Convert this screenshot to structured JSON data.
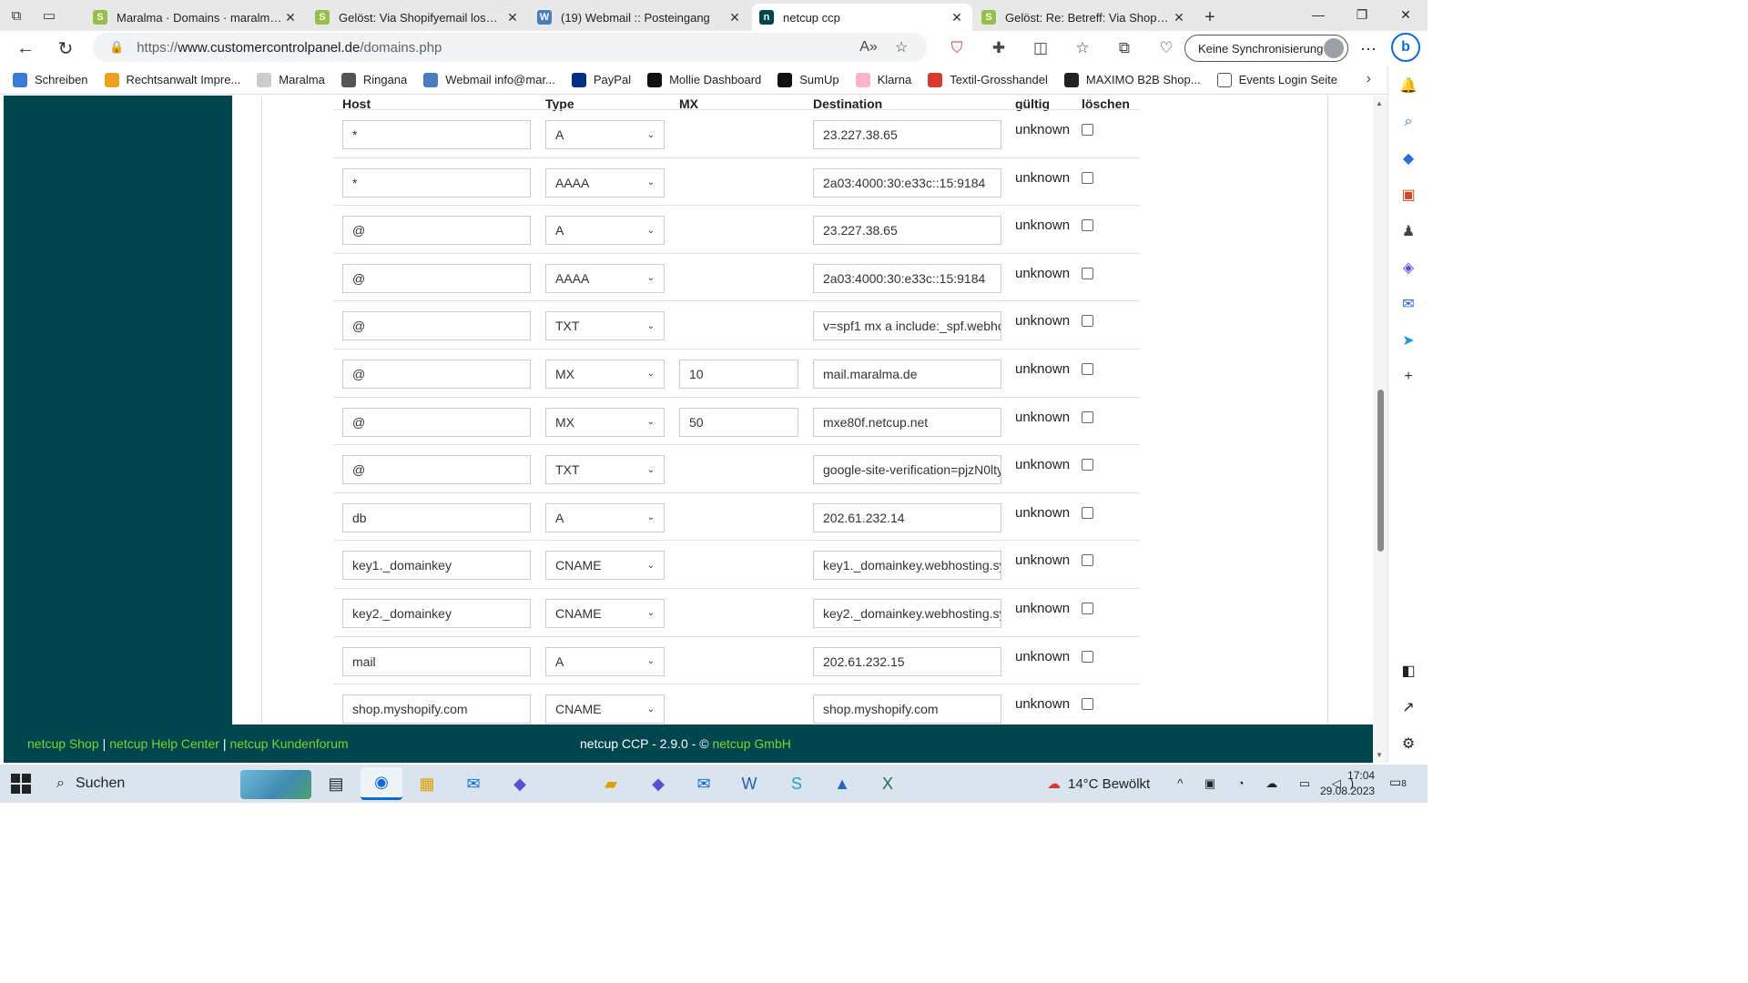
{
  "browser": {
    "tabs": [
      {
        "title": "Maralma · Domains · maralma.de",
        "fav_color": "#95bf47",
        "fav_glyph": "S",
        "active": false
      },
      {
        "title": "Gelöst: Via Shopifyemail loswerden",
        "fav_color": "#95bf47",
        "fav_glyph": "S",
        "active": false
      },
      {
        "title": "(19) Webmail :: Posteingang",
        "fav_color": "#4a7cc0",
        "fav_glyph": "W",
        "active": false
      },
      {
        "title": "netcup ccp",
        "fav_color": "#00464f",
        "fav_glyph": "n",
        "active": true
      },
      {
        "title": "Gelöst: Re: Betreff: Via Shopifyemail",
        "fav_color": "#95bf47",
        "fav_glyph": "S",
        "active": false
      }
    ],
    "url_prefix": "https://",
    "url_host": "www.customercontrolpanel.de",
    "url_path": "/domains.php",
    "sync_label": "Keine Synchronisierung"
  },
  "bookmarks": [
    {
      "label": "Schreiben",
      "color": "#3a7bd5"
    },
    {
      "label": "Rechtsanwalt Impre...",
      "color": "#f0a020"
    },
    {
      "label": "Maralma",
      "color": "#cccccc"
    },
    {
      "label": "Ringana",
      "color": "#555555"
    },
    {
      "label": "Webmail info@mar...",
      "color": "#4a7cc0"
    },
    {
      "label": "PayPal",
      "color": "#003087"
    },
    {
      "label": "Mollie Dashboard",
      "color": "#111111"
    },
    {
      "label": "SumUp",
      "color": "#111111"
    },
    {
      "label": "Klarna",
      "color": "#ffb3c7"
    },
    {
      "label": "Textil-Grosshandel",
      "color": "#d63a2a"
    },
    {
      "label": "MAXIMO B2B Shop...",
      "color": "#222222"
    },
    {
      "label": "Events Login Seite",
      "color": "#ffffff"
    }
  ],
  "table": {
    "headers": {
      "host": "Host",
      "type": "Type",
      "mx": "MX",
      "destination": "Destination",
      "valid": "gültig",
      "delete": "löschen"
    },
    "rows": [
      {
        "host": "*",
        "type": "A",
        "mx": "",
        "destination": " 23.227.38.65",
        "status": "unknown"
      },
      {
        "host": "*",
        "type": "AAAA",
        "mx": "",
        "destination": "2a03:4000:30:e33c::15:9184",
        "status": "unknown"
      },
      {
        "host": "@",
        "type": "A",
        "mx": "",
        "destination": " 23.227.38.65",
        "status": "unknown"
      },
      {
        "host": "@",
        "type": "AAAA",
        "mx": "",
        "destination": "2a03:4000:30:e33c::15:9184",
        "status": "unknown"
      },
      {
        "host": "@",
        "type": "TXT",
        "mx": "",
        "destination": "v=spf1 mx a include:_spf.webho",
        "status": "unknown"
      },
      {
        "host": "@",
        "type": "MX",
        "mx": "10",
        "destination": "mail.maralma.de",
        "status": "unknown"
      },
      {
        "host": "@",
        "type": "MX",
        "mx": "50",
        "destination": "mxe80f.netcup.net",
        "status": "unknown"
      },
      {
        "host": "@",
        "type": "TXT",
        "mx": "",
        "destination": "google-site-verification=pjzN0lty",
        "status": "unknown"
      },
      {
        "host": "db",
        "type": "A",
        "mx": "",
        "destination": "202.61.232.14",
        "status": "unknown"
      },
      {
        "host": "key1._domainkey",
        "type": "CNAME",
        "mx": "",
        "destination": "key1._domainkey.webhosting.sy",
        "status": "unknown"
      },
      {
        "host": "key2._domainkey",
        "type": "CNAME",
        "mx": "",
        "destination": "key2._domainkey.webhosting.sy",
        "status": "unknown"
      },
      {
        "host": "mail",
        "type": "A",
        "mx": "",
        "destination": "202.61.232.15",
        "status": "unknown"
      },
      {
        "host": "shop.myshopify.com",
        "type": "CNAME",
        "mx": "",
        "destination": "shop.myshopify.com",
        "status": "unknown"
      }
    ]
  },
  "footer": {
    "link1": "netcup Shop",
    "link2": "netcup Help Center",
    "link3": "netcup Kundenforum",
    "version_text": "netcup CCP - 2.9.0 - © ",
    "company": "netcup GmbH"
  },
  "taskbar": {
    "search_label": "Suchen",
    "weather": "14°C  Bewölkt",
    "time": "17:04",
    "date": "29.08.2023",
    "notif_count": "8"
  },
  "colors": {
    "brand_teal": "#00464f",
    "link_green": "#7fd32b",
    "accent_blue": "#0a6cd6"
  }
}
